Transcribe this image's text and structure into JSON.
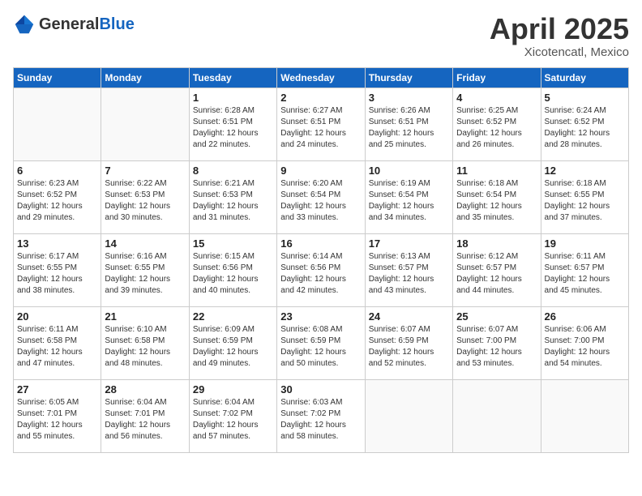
{
  "header": {
    "logo_general": "General",
    "logo_blue": "Blue",
    "month": "April 2025",
    "location": "Xicotencatl, Mexico"
  },
  "weekdays": [
    "Sunday",
    "Monday",
    "Tuesday",
    "Wednesday",
    "Thursday",
    "Friday",
    "Saturday"
  ],
  "weeks": [
    [
      {
        "day": "",
        "empty": true
      },
      {
        "day": "",
        "empty": true
      },
      {
        "day": "1",
        "sunrise": "6:28 AM",
        "sunset": "6:51 PM",
        "daylight": "12 hours and 22 minutes."
      },
      {
        "day": "2",
        "sunrise": "6:27 AM",
        "sunset": "6:51 PM",
        "daylight": "12 hours and 24 minutes."
      },
      {
        "day": "3",
        "sunrise": "6:26 AM",
        "sunset": "6:51 PM",
        "daylight": "12 hours and 25 minutes."
      },
      {
        "day": "4",
        "sunrise": "6:25 AM",
        "sunset": "6:52 PM",
        "daylight": "12 hours and 26 minutes."
      },
      {
        "day": "5",
        "sunrise": "6:24 AM",
        "sunset": "6:52 PM",
        "daylight": "12 hours and 28 minutes."
      }
    ],
    [
      {
        "day": "6",
        "sunrise": "6:23 AM",
        "sunset": "6:52 PM",
        "daylight": "12 hours and 29 minutes."
      },
      {
        "day": "7",
        "sunrise": "6:22 AM",
        "sunset": "6:53 PM",
        "daylight": "12 hours and 30 minutes."
      },
      {
        "day": "8",
        "sunrise": "6:21 AM",
        "sunset": "6:53 PM",
        "daylight": "12 hours and 31 minutes."
      },
      {
        "day": "9",
        "sunrise": "6:20 AM",
        "sunset": "6:54 PM",
        "daylight": "12 hours and 33 minutes."
      },
      {
        "day": "10",
        "sunrise": "6:19 AM",
        "sunset": "6:54 PM",
        "daylight": "12 hours and 34 minutes."
      },
      {
        "day": "11",
        "sunrise": "6:18 AM",
        "sunset": "6:54 PM",
        "daylight": "12 hours and 35 minutes."
      },
      {
        "day": "12",
        "sunrise": "6:18 AM",
        "sunset": "6:55 PM",
        "daylight": "12 hours and 37 minutes."
      }
    ],
    [
      {
        "day": "13",
        "sunrise": "6:17 AM",
        "sunset": "6:55 PM",
        "daylight": "12 hours and 38 minutes."
      },
      {
        "day": "14",
        "sunrise": "6:16 AM",
        "sunset": "6:55 PM",
        "daylight": "12 hours and 39 minutes."
      },
      {
        "day": "15",
        "sunrise": "6:15 AM",
        "sunset": "6:56 PM",
        "daylight": "12 hours and 40 minutes."
      },
      {
        "day": "16",
        "sunrise": "6:14 AM",
        "sunset": "6:56 PM",
        "daylight": "12 hours and 42 minutes."
      },
      {
        "day": "17",
        "sunrise": "6:13 AM",
        "sunset": "6:57 PM",
        "daylight": "12 hours and 43 minutes."
      },
      {
        "day": "18",
        "sunrise": "6:12 AM",
        "sunset": "6:57 PM",
        "daylight": "12 hours and 44 minutes."
      },
      {
        "day": "19",
        "sunrise": "6:11 AM",
        "sunset": "6:57 PM",
        "daylight": "12 hours and 45 minutes."
      }
    ],
    [
      {
        "day": "20",
        "sunrise": "6:11 AM",
        "sunset": "6:58 PM",
        "daylight": "12 hours and 47 minutes."
      },
      {
        "day": "21",
        "sunrise": "6:10 AM",
        "sunset": "6:58 PM",
        "daylight": "12 hours and 48 minutes."
      },
      {
        "day": "22",
        "sunrise": "6:09 AM",
        "sunset": "6:59 PM",
        "daylight": "12 hours and 49 minutes."
      },
      {
        "day": "23",
        "sunrise": "6:08 AM",
        "sunset": "6:59 PM",
        "daylight": "12 hours and 50 minutes."
      },
      {
        "day": "24",
        "sunrise": "6:07 AM",
        "sunset": "6:59 PM",
        "daylight": "12 hours and 52 minutes."
      },
      {
        "day": "25",
        "sunrise": "6:07 AM",
        "sunset": "7:00 PM",
        "daylight": "12 hours and 53 minutes."
      },
      {
        "day": "26",
        "sunrise": "6:06 AM",
        "sunset": "7:00 PM",
        "daylight": "12 hours and 54 minutes."
      }
    ],
    [
      {
        "day": "27",
        "sunrise": "6:05 AM",
        "sunset": "7:01 PM",
        "daylight": "12 hours and 55 minutes."
      },
      {
        "day": "28",
        "sunrise": "6:04 AM",
        "sunset": "7:01 PM",
        "daylight": "12 hours and 56 minutes."
      },
      {
        "day": "29",
        "sunrise": "6:04 AM",
        "sunset": "7:02 PM",
        "daylight": "12 hours and 57 minutes."
      },
      {
        "day": "30",
        "sunrise": "6:03 AM",
        "sunset": "7:02 PM",
        "daylight": "12 hours and 58 minutes."
      },
      {
        "day": "",
        "empty": true
      },
      {
        "day": "",
        "empty": true
      },
      {
        "day": "",
        "empty": true
      }
    ]
  ],
  "labels": {
    "sunrise": "Sunrise:",
    "sunset": "Sunset:",
    "daylight": "Daylight:"
  }
}
